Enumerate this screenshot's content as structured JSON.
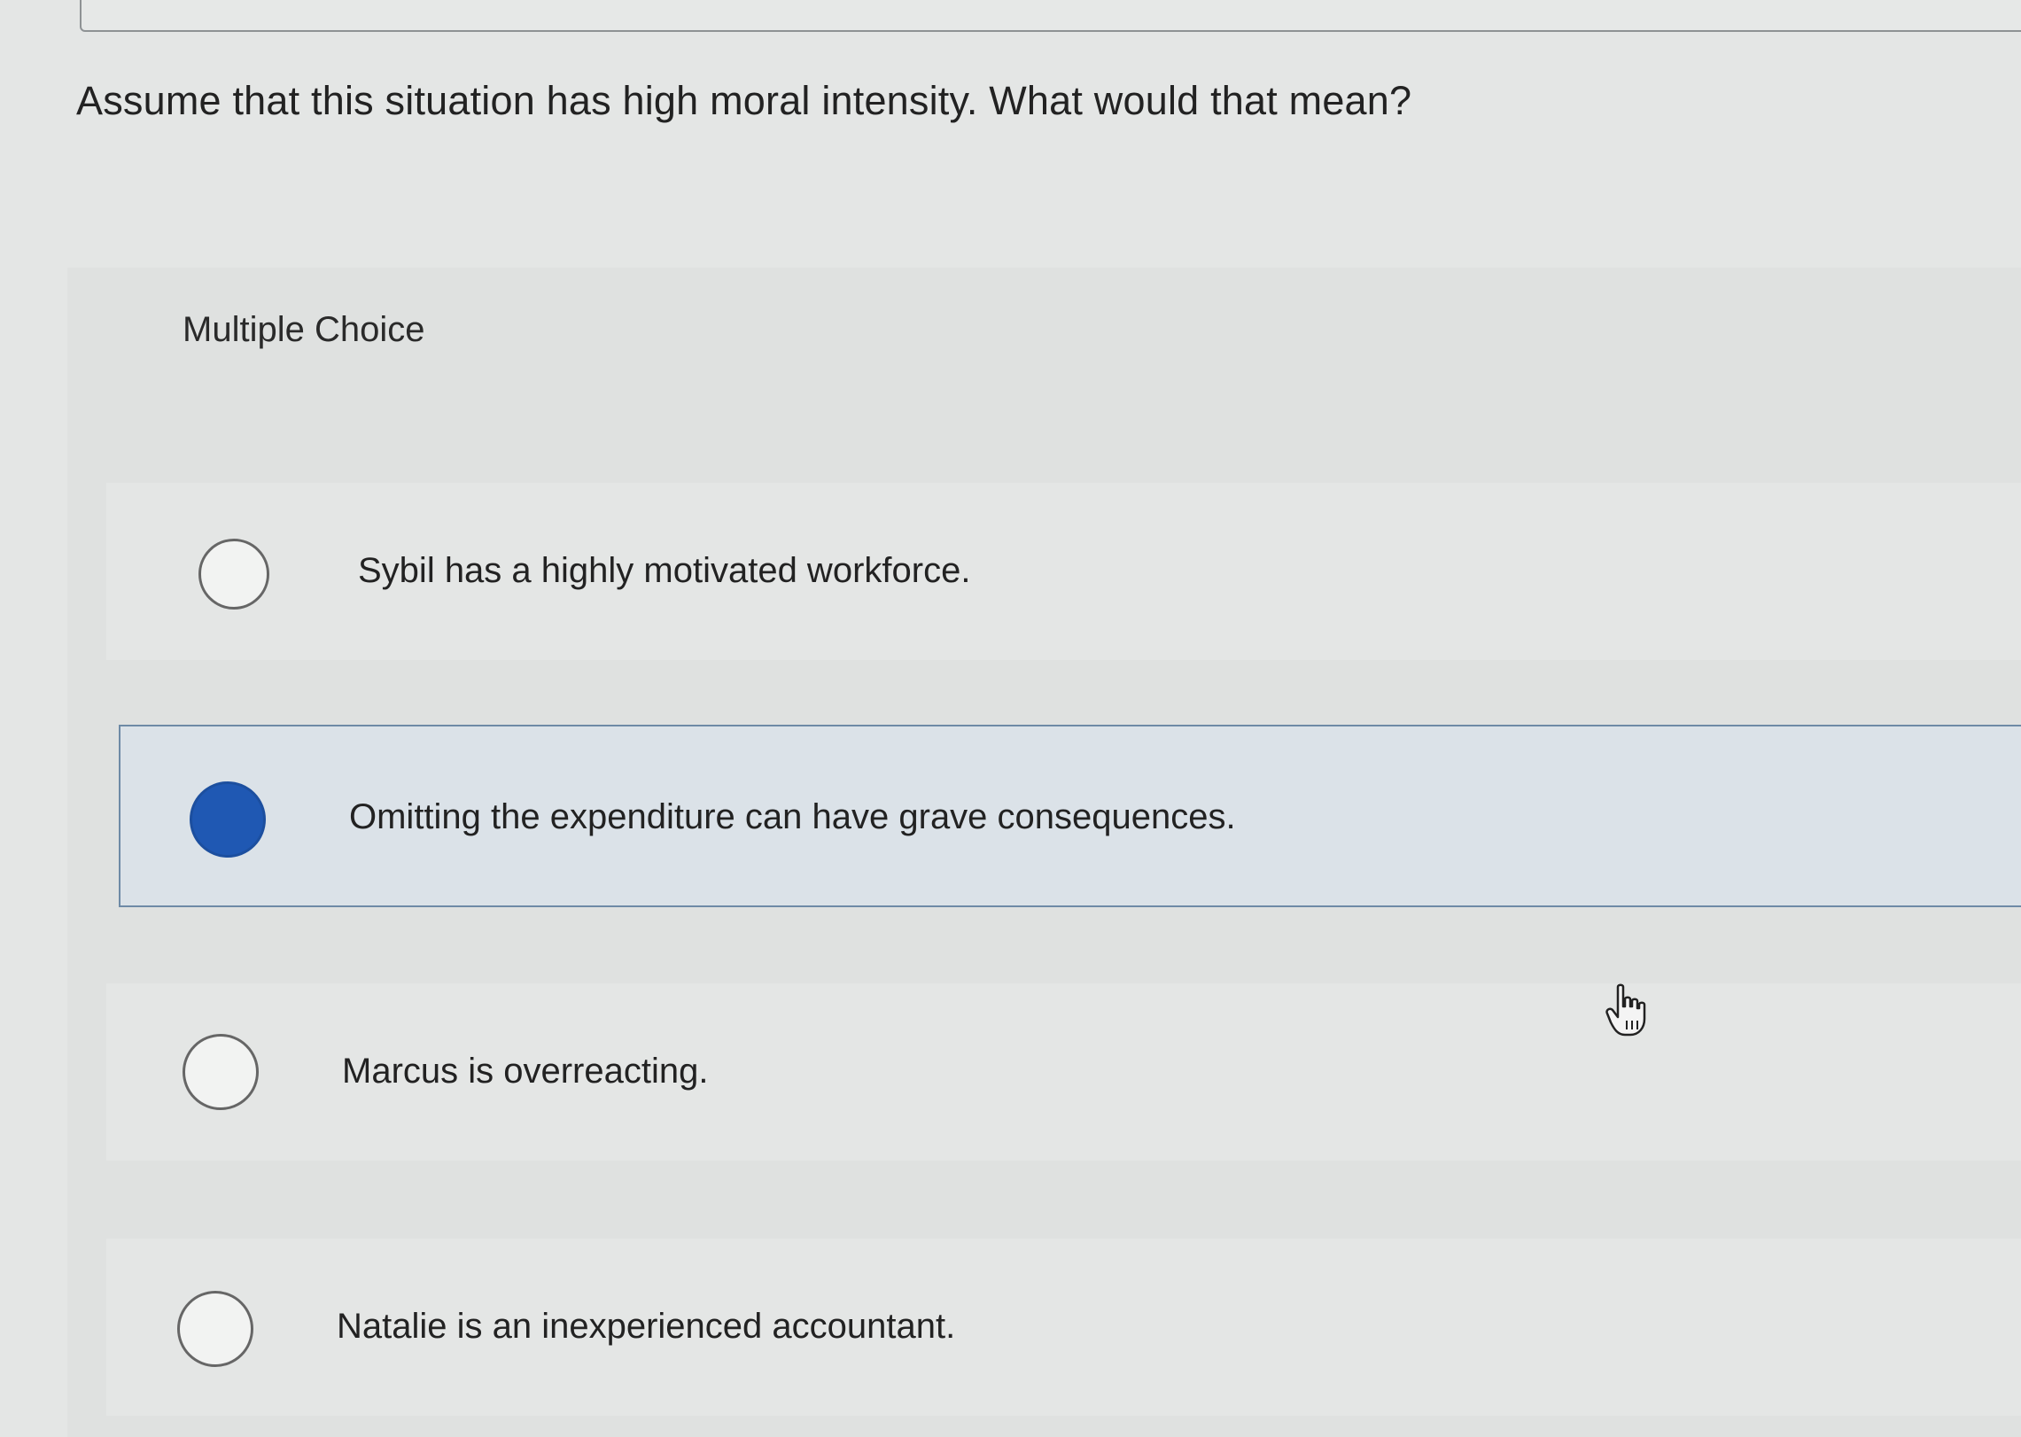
{
  "question": {
    "text": "Assume that this situation has high moral intensity. What would that mean?"
  },
  "choices": {
    "label": "Multiple Choice",
    "options": [
      {
        "text": "Sybil has a highly motivated workforce.",
        "selected": false
      },
      {
        "text": "Omitting the expenditure can have grave consequences.",
        "selected": true
      },
      {
        "text": "Marcus is overreacting.",
        "selected": false
      },
      {
        "text": "Natalie is an inexperienced accountant.",
        "selected": false
      }
    ]
  },
  "colors": {
    "selected_radio": "#1f58b3",
    "selected_row_border": "#6e8aa6",
    "selected_row_bg": "#dbe2e8"
  },
  "icons": {
    "cursor": "hand-pointer-icon"
  }
}
